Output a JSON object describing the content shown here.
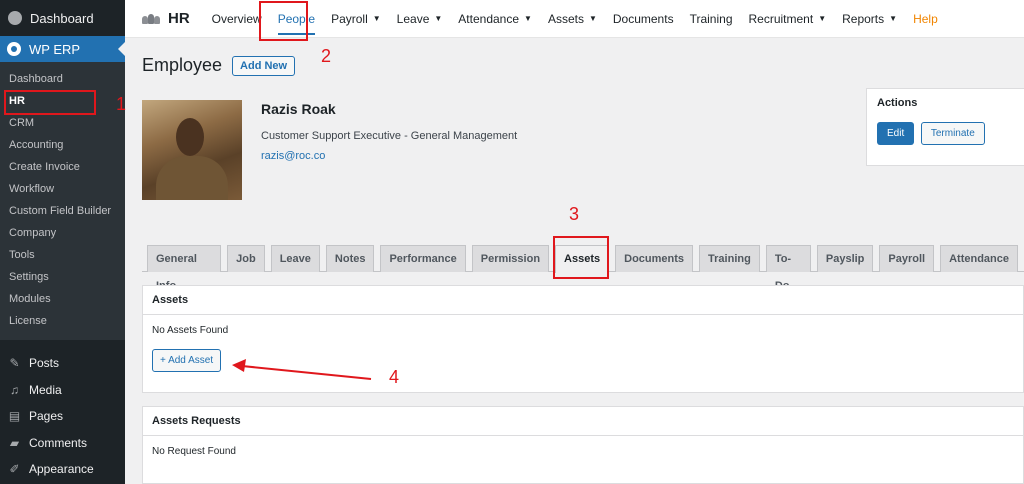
{
  "sidebar": {
    "top": "Dashboard",
    "erp": "WP ERP",
    "submenu": [
      "Dashboard",
      "HR",
      "CRM",
      "Accounting",
      "Create Invoice",
      "Workflow",
      "Custom Field Builder",
      "Company",
      "Tools",
      "Settings",
      "Modules",
      "License"
    ],
    "main": [
      {
        "label": "Posts",
        "icon": "pin-icon"
      },
      {
        "label": "Media",
        "icon": "media-icon"
      },
      {
        "label": "Pages",
        "icon": "pages-icon"
      },
      {
        "label": "Comments",
        "icon": "comments-icon"
      },
      {
        "label": "Appearance",
        "icon": "brush-icon"
      }
    ]
  },
  "topnav": {
    "brand": "HR",
    "items": [
      "Overview",
      "People",
      "Payroll",
      "Leave",
      "Attendance",
      "Assets",
      "Documents",
      "Training",
      "Recruitment",
      "Reports",
      "Help"
    ]
  },
  "page": {
    "title": "Employee",
    "add_new": "Add New"
  },
  "employee": {
    "name": "Razis Roak",
    "role": "Customer Support Executive - General Management",
    "email": "razis@roc.co"
  },
  "actions": {
    "title": "Actions",
    "edit": "Edit",
    "terminate": "Terminate"
  },
  "tabs": [
    "General Info",
    "Job",
    "Leave",
    "Notes",
    "Performance",
    "Permission",
    "Assets",
    "Documents",
    "Training",
    "To-Do",
    "Payslip",
    "Payroll",
    "Attendance"
  ],
  "assets_panel": {
    "title": "Assets",
    "empty": "No Assets Found",
    "add_button": "+ Add Asset"
  },
  "requests_panel": {
    "title": "Assets Requests",
    "empty": "No Request Found"
  },
  "annotations": [
    "1",
    "2",
    "3",
    "4"
  ],
  "colors": {
    "accent": "#2271b1",
    "annotation": "#e0171c",
    "sidebar": "#1d2327",
    "help": "#f18500"
  }
}
